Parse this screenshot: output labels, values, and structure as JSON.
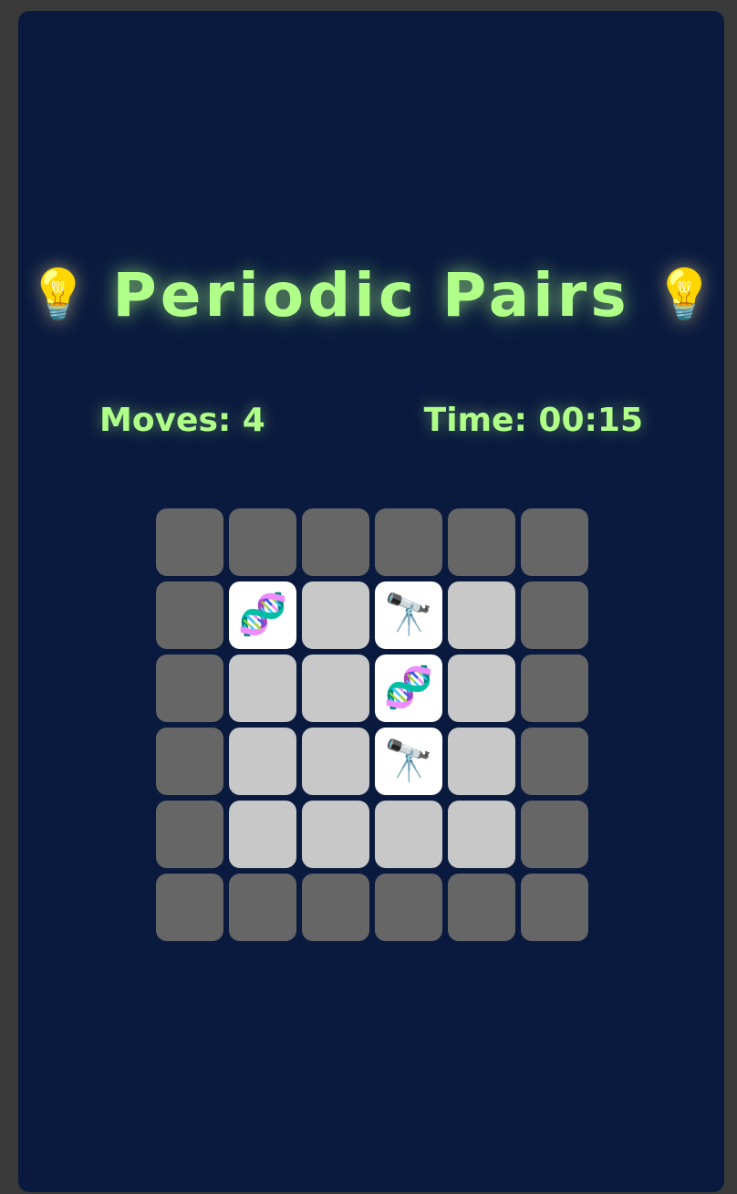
{
  "game": {
    "title": "Periodic Pairs",
    "title_icon_left": "💡",
    "title_icon_right": "💡",
    "title_icon_name": "lightbulb-icon",
    "accent_color": "#b0ff88",
    "background_color": "#0a1a3e"
  },
  "stats": {
    "moves_label": "Moves: 4",
    "time_label": "Time: 00:15"
  },
  "board": {
    "rows": 6,
    "cols": 6,
    "legend": {
      "wall": "border tile (not playable)",
      "hidden": "face-down card",
      "revealed": "face-up card"
    },
    "cells": [
      [
        {
          "state": "wall"
        },
        {
          "state": "wall"
        },
        {
          "state": "wall"
        },
        {
          "state": "wall"
        },
        {
          "state": "wall"
        },
        {
          "state": "wall"
        }
      ],
      [
        {
          "state": "wall"
        },
        {
          "state": "revealed",
          "symbol": "🧬",
          "icon": "dna-icon"
        },
        {
          "state": "hidden"
        },
        {
          "state": "revealed",
          "symbol": "🔭",
          "icon": "telescope-icon"
        },
        {
          "state": "hidden"
        },
        {
          "state": "wall"
        }
      ],
      [
        {
          "state": "wall"
        },
        {
          "state": "hidden"
        },
        {
          "state": "hidden"
        },
        {
          "state": "revealed",
          "symbol": "🧬",
          "icon": "dna-icon"
        },
        {
          "state": "hidden"
        },
        {
          "state": "wall"
        }
      ],
      [
        {
          "state": "wall"
        },
        {
          "state": "hidden"
        },
        {
          "state": "hidden"
        },
        {
          "state": "revealed",
          "symbol": "🔭",
          "icon": "telescope-icon"
        },
        {
          "state": "hidden"
        },
        {
          "state": "wall"
        }
      ],
      [
        {
          "state": "wall"
        },
        {
          "state": "hidden"
        },
        {
          "state": "hidden"
        },
        {
          "state": "hidden"
        },
        {
          "state": "hidden"
        },
        {
          "state": "wall"
        }
      ],
      [
        {
          "state": "wall"
        },
        {
          "state": "wall"
        },
        {
          "state": "wall"
        },
        {
          "state": "wall"
        },
        {
          "state": "wall"
        },
        {
          "state": "wall"
        }
      ]
    ]
  }
}
